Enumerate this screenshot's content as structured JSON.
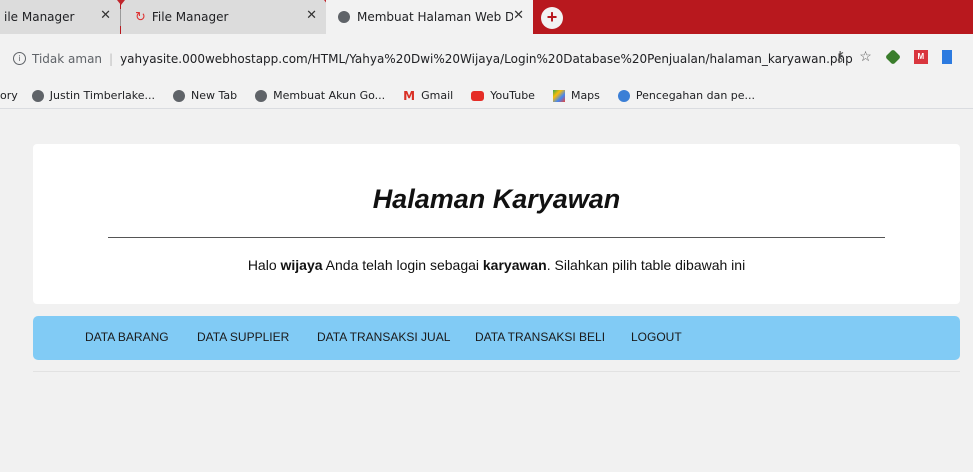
{
  "browser": {
    "tabs": [
      {
        "title": "ile Manager",
        "close": "✕"
      },
      {
        "title": "File Manager",
        "close": "✕"
      },
      {
        "title": "Membuat Halaman Web Dinamis",
        "close": "✕"
      }
    ],
    "new_tab": "+",
    "security_label": "Tidak aman",
    "url": "yahyasite.000webhostapp.com/HTML/Yahya%20Dwi%20Wijaya/Login%20Database%20Penjualan/halaman_karyawan.php",
    "bookmarks": [
      {
        "label": "ory",
        "icon": "none"
      },
      {
        "label": "Justin Timberlake...",
        "icon": "globe-icon"
      },
      {
        "label": "New Tab",
        "icon": "globe-icon"
      },
      {
        "label": "Membuat Akun Go...",
        "icon": "globe-icon"
      },
      {
        "label": "Gmail",
        "icon": "gmail-icon"
      },
      {
        "label": "YouTube",
        "icon": "youtube-icon"
      },
      {
        "label": "Maps",
        "icon": "maps-icon"
      },
      {
        "label": "Pencegahan dan pe...",
        "icon": "who-icon"
      }
    ]
  },
  "page": {
    "title": "Halaman Karyawan",
    "greeting": {
      "prefix": "Halo",
      "username": "wijaya",
      "middle": "Anda telah login sebagai",
      "role": "karyawan",
      "suffix": ". Silahkan pilih table dibawah ini"
    },
    "nav": [
      "DATA BARANG",
      "DATA SUPPLIER",
      "DATA TRANSAKSI JUAL",
      "DATA TRANSAKSI BELI",
      "LOGOUT"
    ]
  },
  "colors": {
    "tabstrip": "#b8181e",
    "navbar": "#81cbf5",
    "page_bg": "#f1f1f1"
  }
}
